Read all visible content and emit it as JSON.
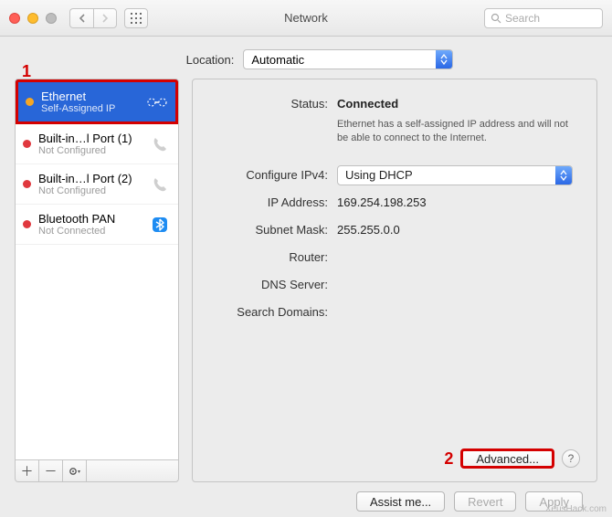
{
  "window": {
    "title": "Network",
    "search_placeholder": "Search"
  },
  "location": {
    "label": "Location:",
    "value": "Automatic"
  },
  "sidebar": {
    "items": [
      {
        "name": "Ethernet",
        "sub": "Self-Assigned IP",
        "dot": "orange",
        "icon": "ethernet-icon",
        "selected": true
      },
      {
        "name": "Built-in…l Port (1)",
        "sub": "Not Configured",
        "dot": "red",
        "icon": "phone-icon",
        "selected": false
      },
      {
        "name": "Built-in…l Port (2)",
        "sub": "Not Configured",
        "dot": "red",
        "icon": "phone-icon",
        "selected": false
      },
      {
        "name": "Bluetooth PAN",
        "sub": "Not Connected",
        "dot": "red",
        "icon": "bluetooth-icon",
        "selected": false
      }
    ]
  },
  "details": {
    "status_label": "Status:",
    "status_value": "Connected",
    "status_hint": "Ethernet has a self-assigned IP address and will not be able to connect to the Internet.",
    "config_label": "Configure IPv4:",
    "config_value": "Using DHCP",
    "ip_label": "IP Address:",
    "ip_value": "169.254.198.253",
    "subnet_label": "Subnet Mask:",
    "subnet_value": "255.255.0.0",
    "router_label": "Router:",
    "router_value": "",
    "dns_label": "DNS Server:",
    "dns_value": "",
    "search_label": "Search Domains:",
    "search_value": ""
  },
  "buttons": {
    "advanced": "Advanced...",
    "assist": "Assist me...",
    "revert": "Revert",
    "apply": "Apply"
  },
  "callouts": {
    "one": "1",
    "two": "2"
  },
  "watermark": "XeusHack.com"
}
